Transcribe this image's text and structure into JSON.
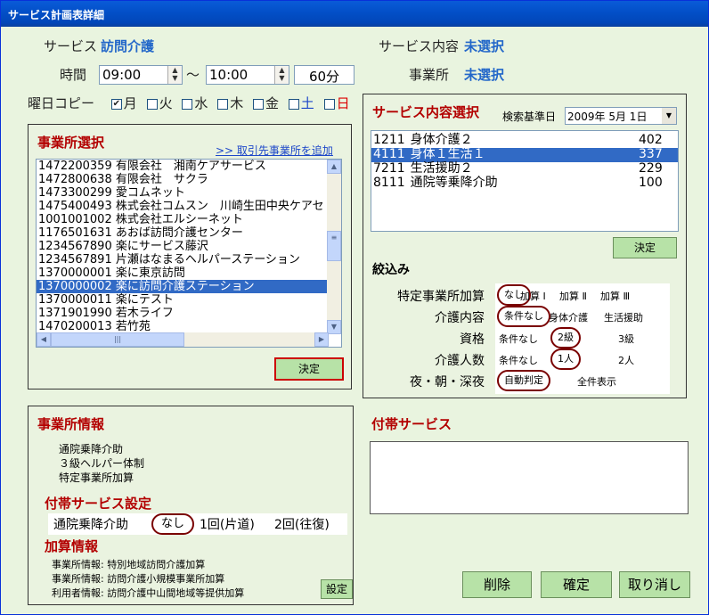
{
  "window": {
    "title": "サービス計画表詳細"
  },
  "header": {
    "service_label": "サービス",
    "service_value": "訪問介護",
    "content_label": "サービス内容",
    "content_value": "未選択",
    "time_label": "時間",
    "start_time": "09:00",
    "tilde": "～",
    "end_time": "10:00",
    "duration": "60分",
    "office_label": "事業所",
    "office_value": "未選択",
    "weekday_copy_label": "曜日コピー",
    "weekdays": [
      {
        "label": "月",
        "checked": true
      },
      {
        "label": "火",
        "checked": false
      },
      {
        "label": "水",
        "checked": false
      },
      {
        "label": "木",
        "checked": false
      },
      {
        "label": "金",
        "checked": false
      },
      {
        "label": "土",
        "checked": false
      },
      {
        "label": "日",
        "checked": false
      }
    ]
  },
  "office_select": {
    "title": "事業所選択",
    "add_link": ">> 取引先事業所を追加",
    "items": [
      "1472200359 有限会社　湘南ケアサービス",
      "1472800638 有限会社　サクラ",
      "1473300299 愛コムネット",
      "1475400493 株式会社コムスン　川崎生田中央ケアセ",
      "1001001002 株式会社エルシーネット",
      "1176501631 あおば訪問介護センター",
      "1234567890 楽にサービス藤沢",
      "1234567891 片瀬はなまるヘルパーステーション",
      "1370000001 楽に東京訪問",
      "1370000002 楽に訪問介護ステーション",
      "1370000011 楽にテスト",
      "1371901990 若木ライフ",
      "1470200013 若竹苑"
    ],
    "selected_index": 9,
    "decide": "決定"
  },
  "service_content": {
    "title": "サービス内容選択",
    "base_date_label": "検索基準日",
    "base_date": "2009年 5月 1日",
    "items": [
      {
        "code": "1211",
        "name": "身体介護２",
        "units": "402"
      },
      {
        "code": "4111",
        "name": "身体１生活１",
        "units": "337"
      },
      {
        "code": "7211",
        "name": "生活援助２",
        "units": "229"
      },
      {
        "code": "8111",
        "name": "通院等乗降介助",
        "units": "100"
      }
    ],
    "selected_index": 1,
    "decide": "決定"
  },
  "filter": {
    "title": "絞込み",
    "rows": [
      {
        "label": "特定事業所加算",
        "options": [
          "なし",
          "加算 Ⅰ",
          "加算 Ⅱ",
          "加算 Ⅲ"
        ]
      },
      {
        "label": "介護内容",
        "options": [
          "条件なし",
          "身体介護",
          "生活援助"
        ]
      },
      {
        "label": "資格",
        "options": [
          "条件なし",
          "2級",
          "3級"
        ]
      },
      {
        "label": "介護人数",
        "options": [
          "条件なし",
          "1人",
          "2人"
        ]
      },
      {
        "label": "夜・朝・深夜",
        "options": [
          "自動判定",
          "全件表示"
        ]
      }
    ]
  },
  "office_info": {
    "title": "事業所情報",
    "lines": [
      "通院乗降介助",
      "３級ヘルパー体制",
      "特定事業所加算"
    ],
    "aux_title": "付帯サービス設定",
    "aux_label": "通院乗降介助",
    "aux_options": [
      "なし",
      "1回(片道)",
      "2回(往復)"
    ],
    "add_title": "加算情報",
    "add_lines": [
      "事業所情報: 特別地域訪問介護加算",
      "事業所情報: 訪問介護小規模事業所加算",
      "利用者情報: 訪問介護中山間地域等提供加算"
    ],
    "setting": "設定"
  },
  "aux_service": {
    "title": "付帯サービス"
  },
  "footer": {
    "delete": "削除",
    "confirm": "確定",
    "cancel": "取り消し"
  }
}
